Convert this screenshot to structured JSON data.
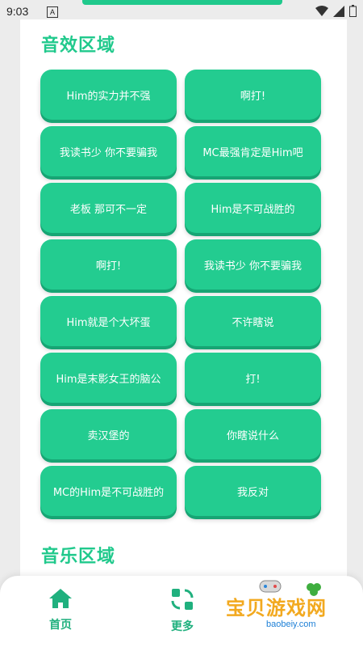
{
  "status_bar": {
    "time": "9:03",
    "notif": "A"
  },
  "sections": {
    "sound": {
      "title": "音效区域"
    },
    "music": {
      "title": "音乐区域"
    }
  },
  "buttons": [
    "Him的实力并不强",
    "啊打!",
    "我读书少 你不要骗我",
    "MC最强肯定是Him吧",
    "老板 那可不一定",
    "Him是不可战胜的",
    "啊打!",
    "我读书少 你不要骗我",
    "Him就是个大坏蛋",
    "不许瞎说",
    "Him是末影女王的脑公",
    "打!",
    "卖汉堡的",
    "你瞎说什么",
    "MC的Him是不可战胜的",
    "我反对"
  ],
  "nav": {
    "home": "首页",
    "more": "更多"
  },
  "watermark": {
    "text": "宝贝游戏网",
    "url": "baobeiy.com"
  },
  "colors": {
    "accent": "#20c98c",
    "button": "#23cc90"
  },
  "icons": {
    "home": "home-icon",
    "more": "more-icon"
  }
}
